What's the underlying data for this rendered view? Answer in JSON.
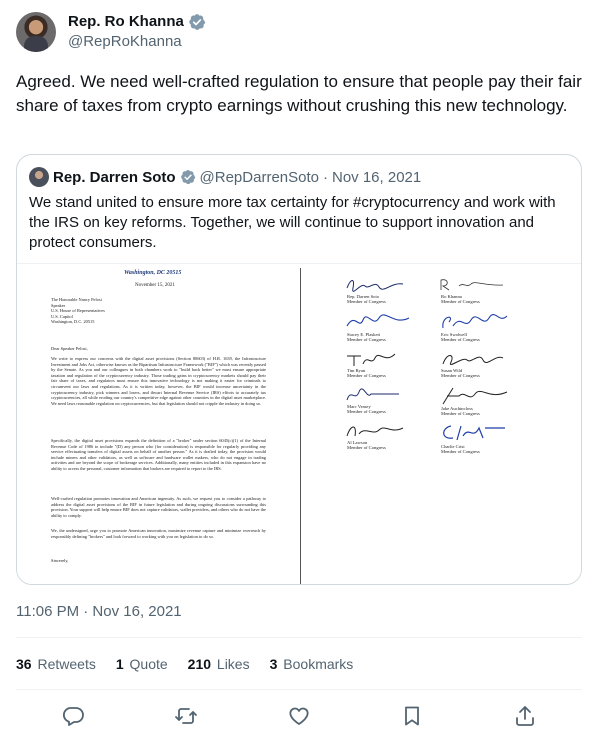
{
  "author": {
    "display_name": "Rep. Ro Khanna",
    "handle": "@RepRoKhanna",
    "verified_icon": "verified-badge-icon"
  },
  "tweet_text": "Agreed. We need well-crafted regulation to ensure that people pay their fair share of taxes from crypto earnings without crushing this new technology.",
  "quoted": {
    "display_name": "Rep. Darren Soto",
    "handle": "@RepDarrenSoto",
    "separator": "·",
    "date": "Nov 16, 2021",
    "text": "We stand united to ensure more tax certainty for #cryptocurrency and work with the IRS on key reforms. Together, we will continue to support innovation and protect consumers.",
    "letter": {
      "letterhead": "Washington, DC 20515",
      "date": "November 15, 2021",
      "address": [
        "The Honorable Nancy Pelosi",
        "Speaker",
        "U.S. House of Representatives",
        "U.S. Capitol",
        "Washington, D.C. 20515"
      ],
      "salutation": "Dear Speaker Pelosi,",
      "paragraphs": [
        "We write to express our concerns with the digital asset provisions (Section 80603) of H.R. 1639, the Infrastructure Investment and Jobs Act, otherwise known as the Bipartisan Infrastructure Framework (\"BIF\") which was recently passed by the Senate. As you and our colleagues in both chambers work to \"build back better\" we must ensure appropriate taxation and regulation of the cryptocurrency industry. Those trading gains in cryptocurrency markets should pay their fair share of taxes, and regulators must ensure this innovative technology is not making it easier for criminals to circumvent our laws and regulations. As it is written today, however, the BIF would increase uncertainty in the cryptocurrency industry, pick winners and losers, and thwart Internal Revenue Service (IRS) efforts to accurately tax cryptocurrencies, all while eroding our country's competitive edge against other countries in the digital asset marketplace. We need laws reasonable regulation on cryptocurrencies, but that legislation should not cripple the industry in doing so.",
        "Specifically, the digital asset provisions expands the definition of a \"broker\" under section 6045(c)(1) of the Internal Revenue Code of 1986 to include \"(D) any person who (for consideration) is responsible for regularly providing any service effectuating transfers of digital assets on behalf of another person.\" As it is drafted today, the provision would include miners and other validators, as well as software and hardware wallet makers, who do not engage in trading activities and are beyond the scope of brokerage services. Additionally, many entities included in this expansion have no ability to access the personal, customer information that brokers are required to report to the IRS.",
        "Well-crafted regulation promotes innovation and American ingenuity. As such, we request you to consider a pathway to address the digital asset provisions of the BIF in future legislation and during ongoing discussions surrounding this provision. Your support will help ensure BIF does not capture validators, wallet providers, and others who do not have the ability to comply.",
        "We, the undersigned, urge you to promote American innovation, maximize revenue capture and minimize overreach by responsibly defining \"brokers\" and look forward to working with you on legislation to do so."
      ],
      "closing": "Sincerely,",
      "signatories": [
        {
          "name": "Rep. Darren Soto",
          "role": "Member of Congress"
        },
        {
          "name": "Ro Khanna",
          "role": "Member of Congress"
        },
        {
          "name": "Stacey E. Plaskett",
          "role": "Member of Congress"
        },
        {
          "name": "Eric Swalwell",
          "role": "Member of Congress"
        },
        {
          "name": "Tim Ryan",
          "role": "Member of Congress"
        },
        {
          "name": "Susan Wild",
          "role": "Member of Congress"
        },
        {
          "name": "Marc Veasey",
          "role": "Member of Congress"
        },
        {
          "name": "Jake Auchincloss",
          "role": "Member of Congress"
        },
        {
          "name": "Al Lawson",
          "role": "Member of Congress"
        },
        {
          "name": "Charlie Crist",
          "role": "Member of Congress"
        }
      ]
    }
  },
  "timestamp": "11:06 PM · Nov 16, 2021",
  "stats": {
    "retweets": {
      "count": "36",
      "label": "Retweets"
    },
    "quotes": {
      "count": "1",
      "label": "Quote"
    },
    "likes": {
      "count": "210",
      "label": "Likes"
    },
    "bookmarks": {
      "count": "3",
      "label": "Bookmarks"
    }
  },
  "actions": [
    "reply-icon",
    "retweet-icon",
    "like-icon",
    "bookmark-icon",
    "share-icon"
  ],
  "colors": {
    "text": "#0f1419",
    "secondary": "#536471",
    "border": "#cfd9de",
    "verified": "#829aab",
    "icon": "#536471"
  }
}
